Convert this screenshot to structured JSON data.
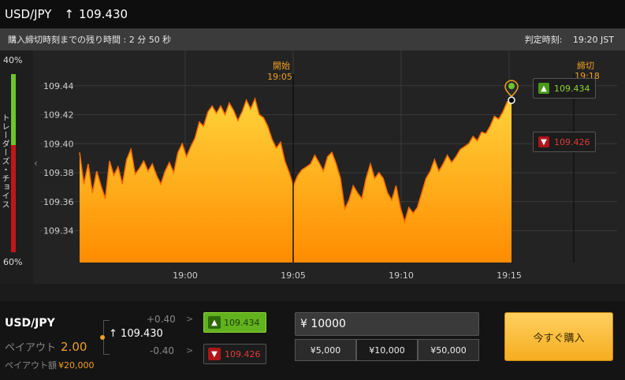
{
  "header": {
    "pair": "USD/JPY",
    "arrow": "↑",
    "price": "109.430"
  },
  "info": {
    "countdown": "購入締切時刻までの残り時間 : 2 分 50 秒",
    "judge_label": "判定時刻:",
    "judge_time": "19:20 JST"
  },
  "sentiment": {
    "top_pct": "40%",
    "bottom_pct": "60%",
    "label": "トレーダーズ・チョイス",
    "up_fraction": 0.4
  },
  "chart_data": {
    "type": "area",
    "x_ticks": [
      "19:00",
      "19:05",
      "19:10",
      "19:15"
    ],
    "y_ticks": [
      "109.44",
      "109.42",
      "109.40",
      "109.38",
      "109.36",
      "109.34"
    ],
    "ylim": [
      109.318,
      109.46
    ],
    "start_marker": {
      "label": "開始",
      "time": "19:05"
    },
    "end_marker": {
      "label": "締切",
      "time": "19:18"
    },
    "fill_color": "#ffb319",
    "line_color": "#ff6a00",
    "values": [
      109.394,
      109.372,
      109.386,
      109.366,
      109.381,
      109.371,
      109.362,
      109.388,
      109.378,
      109.384,
      109.372,
      109.389,
      109.396,
      109.379,
      109.383,
      109.388,
      109.381,
      109.386,
      109.378,
      109.372,
      109.381,
      109.387,
      109.38,
      109.394,
      109.4,
      109.391,
      109.398,
      109.404,
      109.415,
      109.412,
      109.422,
      109.426,
      109.421,
      109.426,
      109.42,
      109.428,
      109.423,
      109.416,
      109.422,
      109.43,
      109.424,
      109.431,
      109.42,
      109.418,
      109.412,
      109.403,
      109.397,
      109.401,
      109.388,
      109.38,
      109.371,
      109.378,
      109.382,
      109.384,
      109.386,
      109.392,
      109.387,
      109.381,
      109.391,
      109.394,
      109.386,
      109.376,
      109.355,
      109.361,
      109.371,
      109.366,
      109.362,
      109.376,
      109.386,
      109.376,
      109.38,
      109.376,
      109.366,
      109.361,
      109.371,
      109.356,
      109.346,
      109.356,
      109.352,
      109.356,
      109.366,
      109.376,
      109.381,
      109.389,
      109.381,
      109.386,
      109.392,
      109.387,
      109.391,
      109.396,
      109.398,
      109.4,
      109.405,
      109.402,
      109.408,
      109.407,
      109.412,
      109.419,
      109.417,
      109.422,
      109.429,
      109.43
    ]
  },
  "strikes": {
    "upper": "109.434",
    "lower": "109.426"
  },
  "bottom": {
    "pair": "USD/JPY",
    "payout_label": "ペイアウト",
    "payout": "2.00",
    "payout_amt_label": "ペイアウト額",
    "payout_amt": "¥20,000",
    "plus": "+0.40",
    "minus": "-0.40",
    "gt": ">",
    "current_arrow": "↑",
    "current": "109.430",
    "up_value": "109.434",
    "down_value": "109.426",
    "amount": "¥ 10000",
    "presets": [
      "¥5,000",
      "¥10,000",
      "¥50,000"
    ],
    "buy_label": "今すぐ購入"
  },
  "icons": {
    "up": "arrow-up-icon",
    "down": "arrow-down-icon",
    "collapse": "chevron-left-icon",
    "marker": "price-pin-icon"
  },
  "colors": {
    "up": "#6cc62c",
    "down": "#c0161a",
    "accent": "#f0a020"
  }
}
